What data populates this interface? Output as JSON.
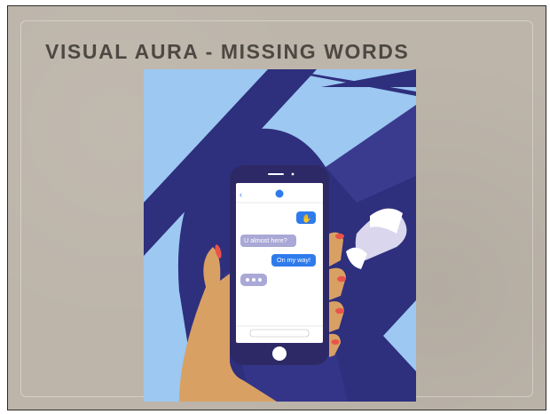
{
  "slide": {
    "title": "VISUAL AURA - MISSING WORDS"
  },
  "illustration": {
    "description_name": "phone-texting-illustration",
    "messages": [
      {
        "from": "me",
        "content": "wave-emoji"
      },
      {
        "from": "them",
        "text": "U almost here?"
      },
      {
        "from": "me",
        "text": "On my way!"
      },
      {
        "from": "them",
        "content": "typing-indicator"
      }
    ]
  },
  "colors": {
    "background": "#bdb5aa",
    "title": "#4d4842",
    "sky": "#9cc8f2",
    "navy": "#2e2f7d",
    "phone": "#2c2966",
    "sent_bubble": "#2f7bec",
    "received_bubble": "#a9a8d6",
    "skin": "#d9a064",
    "nails": "#e8544a"
  }
}
